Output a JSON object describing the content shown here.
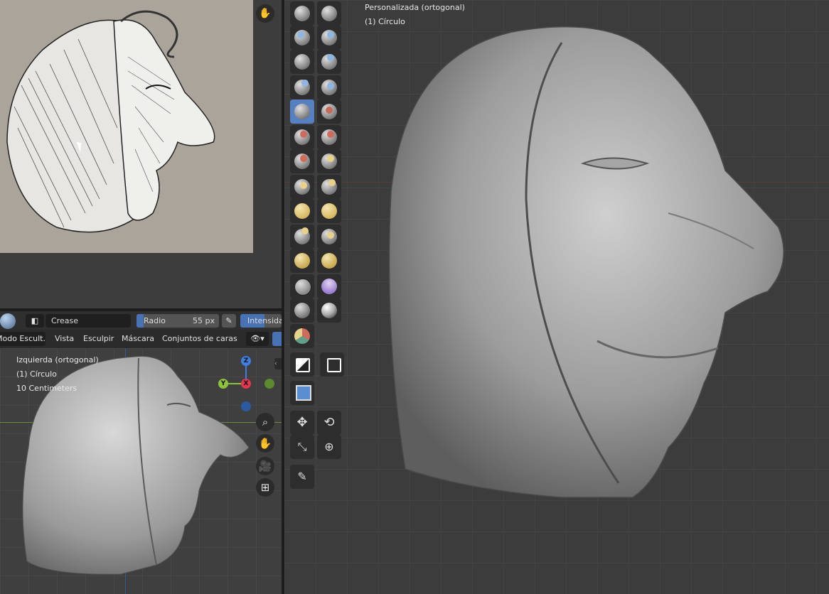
{
  "reference_panel": {},
  "tool_header": {
    "brush_name": "Crease",
    "radius_label": "Radio",
    "radius_value": "55 px",
    "strength_label": "Intensidad"
  },
  "menu_header": {
    "mode_label": "Modo Escult...",
    "items": [
      "Vista",
      "Esculpir",
      "Máscara",
      "Conjuntos de caras"
    ]
  },
  "left_viewport": {
    "view_name": "Izquierda (ortogonal)",
    "object_name": "(1) Círculo",
    "scale": "10 Centimeters"
  },
  "main_viewport": {
    "view_name": "Personalizada (ortogonal)",
    "object_name": "(1) Círculo"
  },
  "axes": {
    "z": "Z",
    "y": "Y",
    "x": "X"
  },
  "colors": {
    "active_tool": "#5680c2",
    "axis_x": "#e8344f",
    "axis_y": "#8ec13c",
    "axis_z": "#3c7fe0",
    "strength_field": "#4772b3"
  }
}
